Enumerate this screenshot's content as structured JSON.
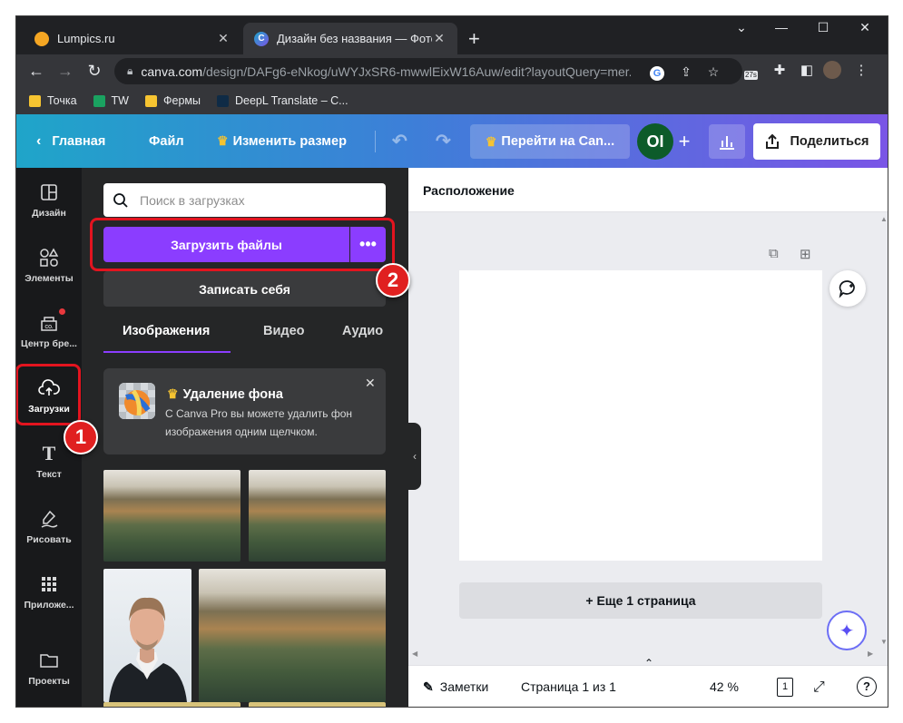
{
  "browser": {
    "tabs": [
      {
        "title": "Lumpics.ru",
        "favicon_color": "#f5a623"
      },
      {
        "title": "Дизайн без названия — Фотокс",
        "favicon_color": "#1fa5c9"
      }
    ],
    "url_host": "canva.com",
    "url_path": "/design/DAFg6-eNkog/uWYJxSR6-mwwlEixW16Auw/edit?layoutQuery=mer...",
    "extension_badge": "27s",
    "bookmarks": [
      {
        "label": "Точка",
        "color": "#f6c431"
      },
      {
        "label": "TW",
        "color": "#1aa260"
      },
      {
        "label": "Фермы",
        "color": "#f6c431"
      },
      {
        "label": "DeepL Translate – C...",
        "color": "#0f2b46"
      }
    ]
  },
  "header": {
    "home": "Главная",
    "file": "Файл",
    "resize": "Изменить размер",
    "pro": "Перейти на Can...",
    "avatar_initials": "OI",
    "share": "Поделиться"
  },
  "leftnav": [
    {
      "label": "Дизайн",
      "icon": "layout-icon"
    },
    {
      "label": "Элементы",
      "icon": "shapes-icon"
    },
    {
      "label": "Центр бре...",
      "icon": "brand-icon"
    },
    {
      "label": "Загрузки",
      "icon": "cloud-upload-icon"
    },
    {
      "label": "Текст",
      "icon": "text-icon"
    },
    {
      "label": "Рисовать",
      "icon": "draw-icon"
    },
    {
      "label": "Приложе...",
      "icon": "apps-icon"
    },
    {
      "label": "Проекты",
      "icon": "folder-icon"
    }
  ],
  "panel": {
    "search_placeholder": "Поиск в загрузках",
    "upload_button": "Загрузить файлы",
    "more_button": "•••",
    "record_button": "Записать себя",
    "tabs": [
      "Изображения",
      "Видео",
      "Аудио"
    ],
    "promo": {
      "title": "Удаление фона",
      "text": "С Canva Pro вы можете удалить фон изображения одним щелчком."
    }
  },
  "annotations": {
    "badge1": "1",
    "badge2": "2",
    "highlight_color": "#e3141f"
  },
  "workspace": {
    "position_label": "Расположение",
    "add_page": "+ Еще 1 страница",
    "notes": "Заметки",
    "page_info": "Страница 1 из 1",
    "zoom": "42 %",
    "page_count": "1"
  }
}
